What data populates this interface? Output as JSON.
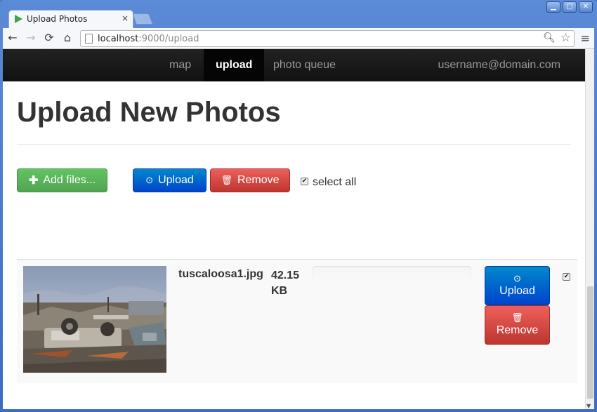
{
  "browser": {
    "tab_title": "Upload Photos",
    "tab_close": "×",
    "url_host": "localhost",
    "url_rest": ":9000/upload"
  },
  "nav": {
    "items": [
      {
        "label": "map",
        "active": false
      },
      {
        "label": "upload",
        "active": true
      },
      {
        "label": "photo queue",
        "active": false
      }
    ],
    "user": "username@domain.com"
  },
  "page": {
    "title": "Upload New Photos"
  },
  "toolbar": {
    "add_label": "Add files...",
    "upload_label": "Upload",
    "remove_label": "Remove",
    "select_all_label": "select all",
    "select_all_checked": true
  },
  "files": [
    {
      "name": "tuscaloosa1.jpg",
      "size": "42.15 KB",
      "progress": 0,
      "upload_label": "Upload",
      "remove_label": "Remove",
      "checked": true
    }
  ],
  "colors": {
    "success": "#5bb75b",
    "primary": "#006dcc",
    "danger": "#da4f49",
    "navbar": "#1b1b1b"
  }
}
